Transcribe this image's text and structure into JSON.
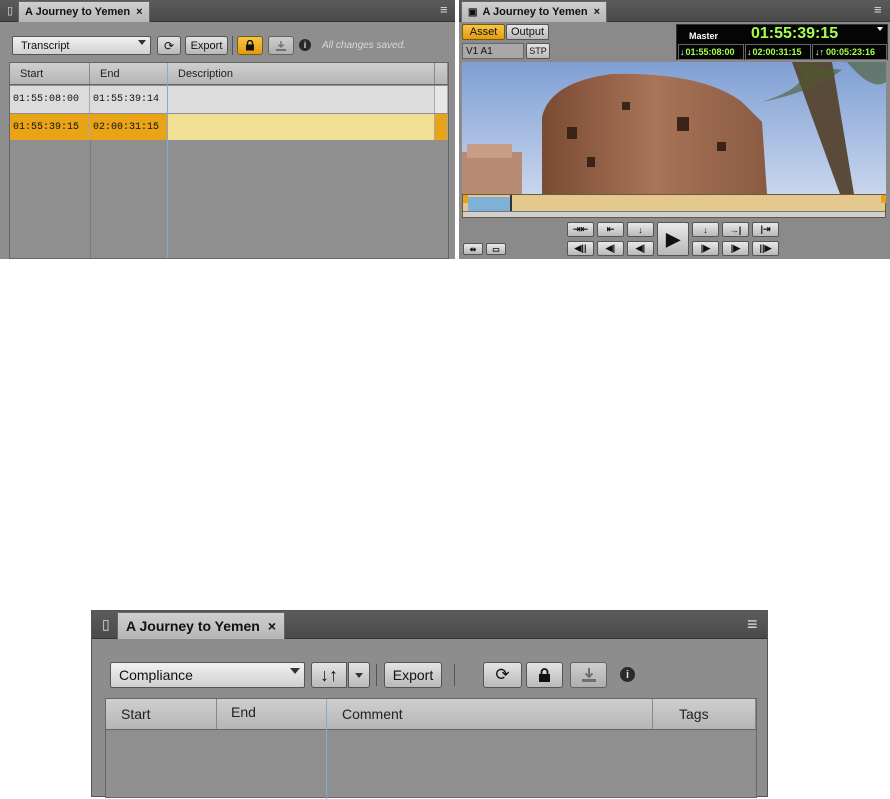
{
  "left_panel": {
    "tab_title": "A Journey to Yemen",
    "close_glyph": "×",
    "menu_glyph": "≡",
    "dropdown_value": "Transcript",
    "export_label": "Export",
    "status_text": "All changes saved.",
    "icons": [
      "refresh-icon",
      "lock-icon",
      "download-icon",
      "info-icon"
    ],
    "columns": [
      "Start",
      "End",
      "Description"
    ],
    "rows": [
      {
        "start": "01:55:08:00",
        "end": "01:55:39:14",
        "description": ""
      },
      {
        "start": "01:55:39:15",
        "end": "02:00:31:15",
        "description": ""
      }
    ],
    "selected_row": 1,
    "accent_color": "#e8a317"
  },
  "right_panel": {
    "tab_title": "A Journey to Yemen",
    "close_glyph": "×",
    "menu_glyph": "≡",
    "asset_tab": "Asset",
    "output_tab": "Output",
    "track_label": "V1 A1",
    "stp_label": "STP",
    "timecode": {
      "label": "Master",
      "main": "01:55:39:15",
      "mark_in": "01:55:08:00",
      "mark_out": "02:00:31:15",
      "duration": "00:05:23:16",
      "color": "#a6ff4d"
    },
    "transport_row1": [
      "⇥⇤",
      "⇤",
      "↓",
      "↓",
      "→|",
      "|⇥"
    ],
    "transport_row2": [
      "◀||",
      "◀|",
      "◀|",
      "|▶",
      "|▶",
      "||▶"
    ],
    "play_glyph": "▶"
  },
  "bottom_panel": {
    "tab_title": "A Journey to Yemen",
    "close_glyph": "×",
    "menu_glyph": "≡",
    "dropdown_value": "Compliance",
    "sort_glyph": "↓↑",
    "export_label": "Export",
    "icons": [
      "refresh-icon",
      "lock-icon",
      "download-icon",
      "info-icon"
    ],
    "columns": [
      "Start",
      "End",
      "Comment",
      "Tags"
    ]
  }
}
